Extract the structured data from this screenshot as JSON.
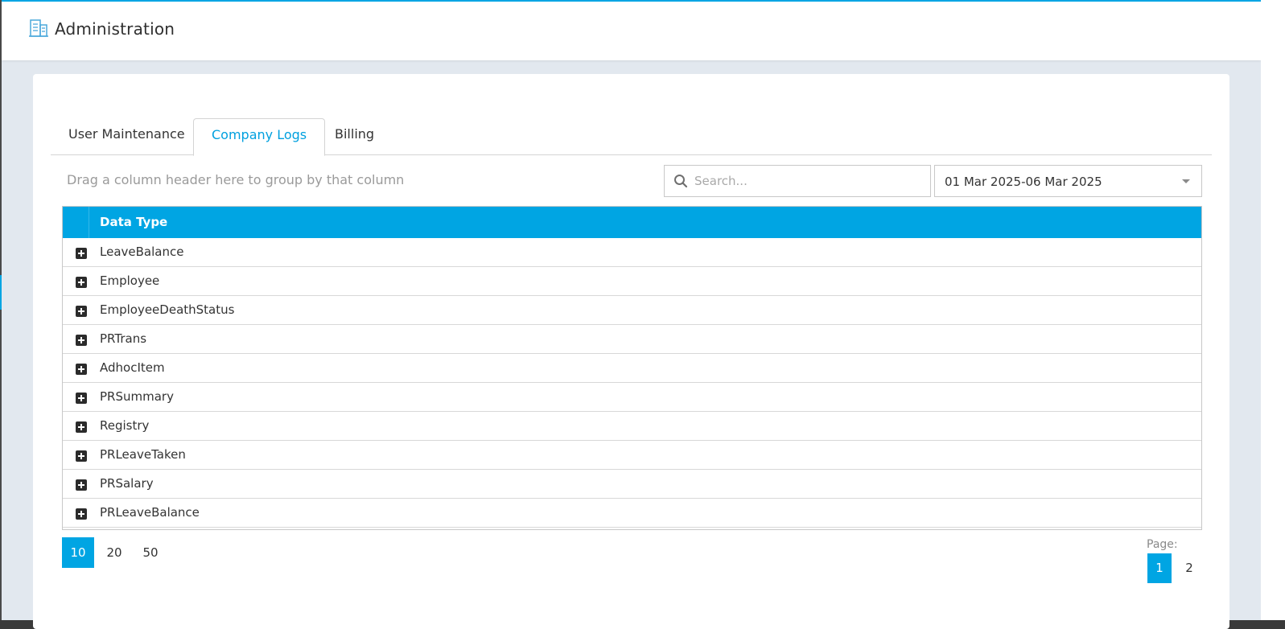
{
  "header": {
    "title": "Administration",
    "icon": "building-icon"
  },
  "tabs": [
    {
      "label": "User Maintenance",
      "active": false
    },
    {
      "label": "Company Logs",
      "active": true
    },
    {
      "label": "Billing",
      "active": false
    }
  ],
  "toolbar": {
    "group_hint": "Drag a column header here to group by that column",
    "search_placeholder": "Search...",
    "search_value": "",
    "date_range": "01 Mar 2025-06 Mar 2025"
  },
  "grid": {
    "columns": [
      "Data Type"
    ],
    "rows": [
      {
        "data_type": "LeaveBalance"
      },
      {
        "data_type": "Employee"
      },
      {
        "data_type": "EmployeeDeathStatus"
      },
      {
        "data_type": "PRTrans"
      },
      {
        "data_type": "AdhocItem"
      },
      {
        "data_type": "PRSummary"
      },
      {
        "data_type": "Registry"
      },
      {
        "data_type": "PRLeaveTaken"
      },
      {
        "data_type": "PRSalary"
      },
      {
        "data_type": "PRLeaveBalance"
      }
    ]
  },
  "pagination": {
    "page_sizes": [
      "10",
      "20",
      "50"
    ],
    "selected_page_size": "10",
    "page_label": "Page:",
    "pages": [
      "1",
      "2"
    ],
    "current_page": "1"
  },
  "colors": {
    "accent": "#00a5e3",
    "header_bg": "#ffffff",
    "frame_bg": "#e2e8ef"
  }
}
